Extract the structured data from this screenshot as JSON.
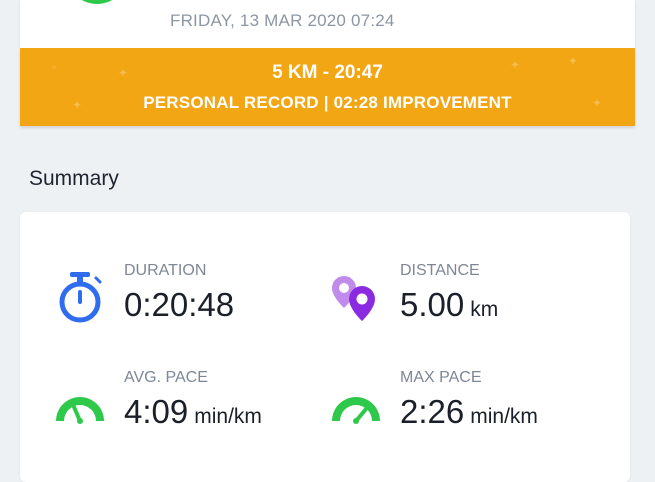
{
  "header": {
    "date": "FRIDAY, 13 MAR 2020 07:24"
  },
  "record_banner": {
    "line1": "5 KM  -  20:47",
    "line2": "PERSONAL RECORD  |  02:28 IMPROVEMENT",
    "color": "#f2a614"
  },
  "summary": {
    "title": "Summary",
    "duration": {
      "label": "DURATION",
      "value": "0:20:48",
      "unit": "",
      "icon": "stopwatch-icon",
      "color": "#2f6cf0"
    },
    "distance": {
      "label": "DISTANCE",
      "value": "5.00",
      "unit": "km",
      "icon": "location-pins-icon",
      "color": "#8a2be2"
    },
    "avg_pace": {
      "label": "AVG. PACE",
      "value": "4:09",
      "unit": "min/km",
      "icon": "speedometer-icon",
      "color": "#2ec84a"
    },
    "max_pace": {
      "label": "MAX PACE",
      "value": "2:26",
      "unit": "min/km",
      "icon": "speedometer-icon",
      "color": "#2ec84a"
    }
  },
  "colors": {
    "background": "#eef1f4",
    "accent_green": "#2ec84a"
  }
}
